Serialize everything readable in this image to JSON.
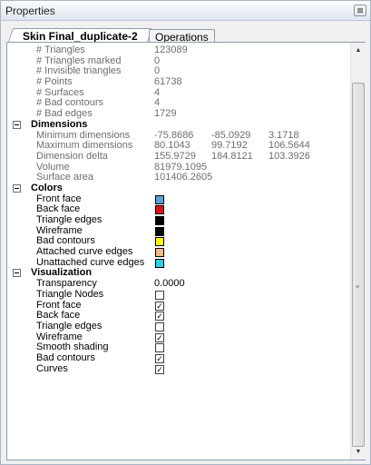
{
  "window": {
    "title": "Properties",
    "close_glyph": "⊠"
  },
  "tabs": [
    {
      "label": "Skin Final_duplicate-2",
      "active": true
    },
    {
      "label": "Operations",
      "active": false
    }
  ],
  "stats": [
    {
      "label": "# Triangles",
      "value": "123089"
    },
    {
      "label": "# Triangles marked",
      "value": "0"
    },
    {
      "label": "# Invisible triangles",
      "value": "0"
    },
    {
      "label": "# Points",
      "value": "61738"
    },
    {
      "label": "# Surfaces",
      "value": "4"
    },
    {
      "label": "# Bad contours",
      "value": "4"
    },
    {
      "label": "# Bad edges",
      "value": "1729"
    }
  ],
  "dimensions": {
    "title": "Dimensions",
    "rows": [
      {
        "label": "Minimum dimensions",
        "x": "-75.8686",
        "y": "-85.0929",
        "z": "3.1718"
      },
      {
        "label": "Maximum dimensions",
        "x": "80.1043",
        "y": "99.7192",
        "z": "106.5644"
      },
      {
        "label": "Dimension delta",
        "x": "155.9729",
        "y": "184.8121",
        "z": "103.3926"
      },
      {
        "label": "Volume",
        "x": "81979.1095"
      },
      {
        "label": "Surface area",
        "x": "101406.2605"
      }
    ]
  },
  "colors": {
    "title": "Colors",
    "rows": [
      {
        "label": "Front face",
        "color": "#5aa3d8"
      },
      {
        "label": "Back face",
        "color": "#e01010"
      },
      {
        "label": "Triangle edges",
        "color": "#000000"
      },
      {
        "label": "Wireframe",
        "color": "#000000"
      },
      {
        "label": "Bad contours",
        "color": "#ffff00"
      },
      {
        "label": "Attached curve edges",
        "color": "#f4b98a"
      },
      {
        "label": "Unattached curve edges",
        "color": "#22d4e6"
      }
    ]
  },
  "visualization": {
    "title": "Visualization",
    "transparency": {
      "label": "Transparency",
      "value": "0.0000"
    },
    "rows": [
      {
        "label": "Triangle Nodes",
        "checked": false
      },
      {
        "label": "Front face",
        "checked": true
      },
      {
        "label": "Back face",
        "checked": true
      },
      {
        "label": "Triangle edges",
        "checked": false
      },
      {
        "label": "Wireframe",
        "checked": true
      },
      {
        "label": "Smooth shading",
        "checked": false
      },
      {
        "label": "Bad contours",
        "checked": true
      },
      {
        "label": "Curves",
        "checked": true
      }
    ]
  },
  "icons": {
    "collapse": "minus-box-icon",
    "scroll_up": "arrow-up-icon",
    "scroll_down": "arrow-down-icon",
    "check_glyph": "✓"
  }
}
